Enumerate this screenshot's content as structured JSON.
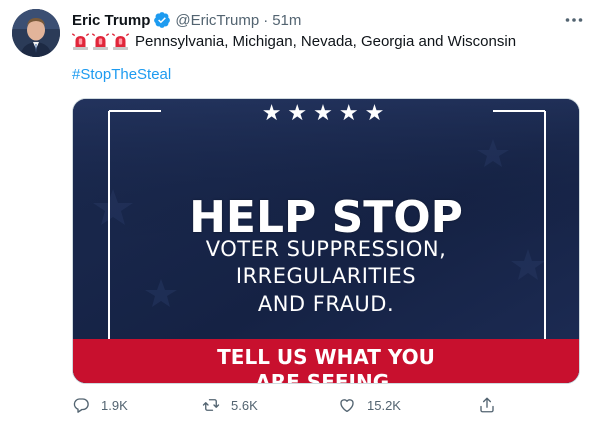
{
  "tweet": {
    "author_name": "Eric Trump",
    "handle": "@EricTrump",
    "separator": "·",
    "time": "51m",
    "text": "Pennsylvania, Michigan, Nevada, Georgia and Wisconsin",
    "hashtag": "#StopTheSteal",
    "icons": {
      "verified": "verified-badge-icon",
      "more": "more-options-icon",
      "siren": "police-light-emoji-icon",
      "reply": "reply-icon",
      "retweet": "retweet-icon",
      "like": "heart-icon",
      "share": "share-icon"
    }
  },
  "media": {
    "stars": "★★★★★",
    "headline": "HELP STOP",
    "line1": "VOTER SUPPRESSION,",
    "line2": "IRREGULARITIES",
    "line3": "AND FRAUD.",
    "cta1": "TELL US WHAT YOU",
    "cta2": "ARE SEEING."
  },
  "actions": {
    "replies": "1.9K",
    "retweets": "5.6K",
    "likes": "15.2K"
  },
  "colors": {
    "accent": "#1d9bf0",
    "text_secondary": "#536471",
    "media_navy": "#18264a",
    "media_red": "#c8102e"
  }
}
